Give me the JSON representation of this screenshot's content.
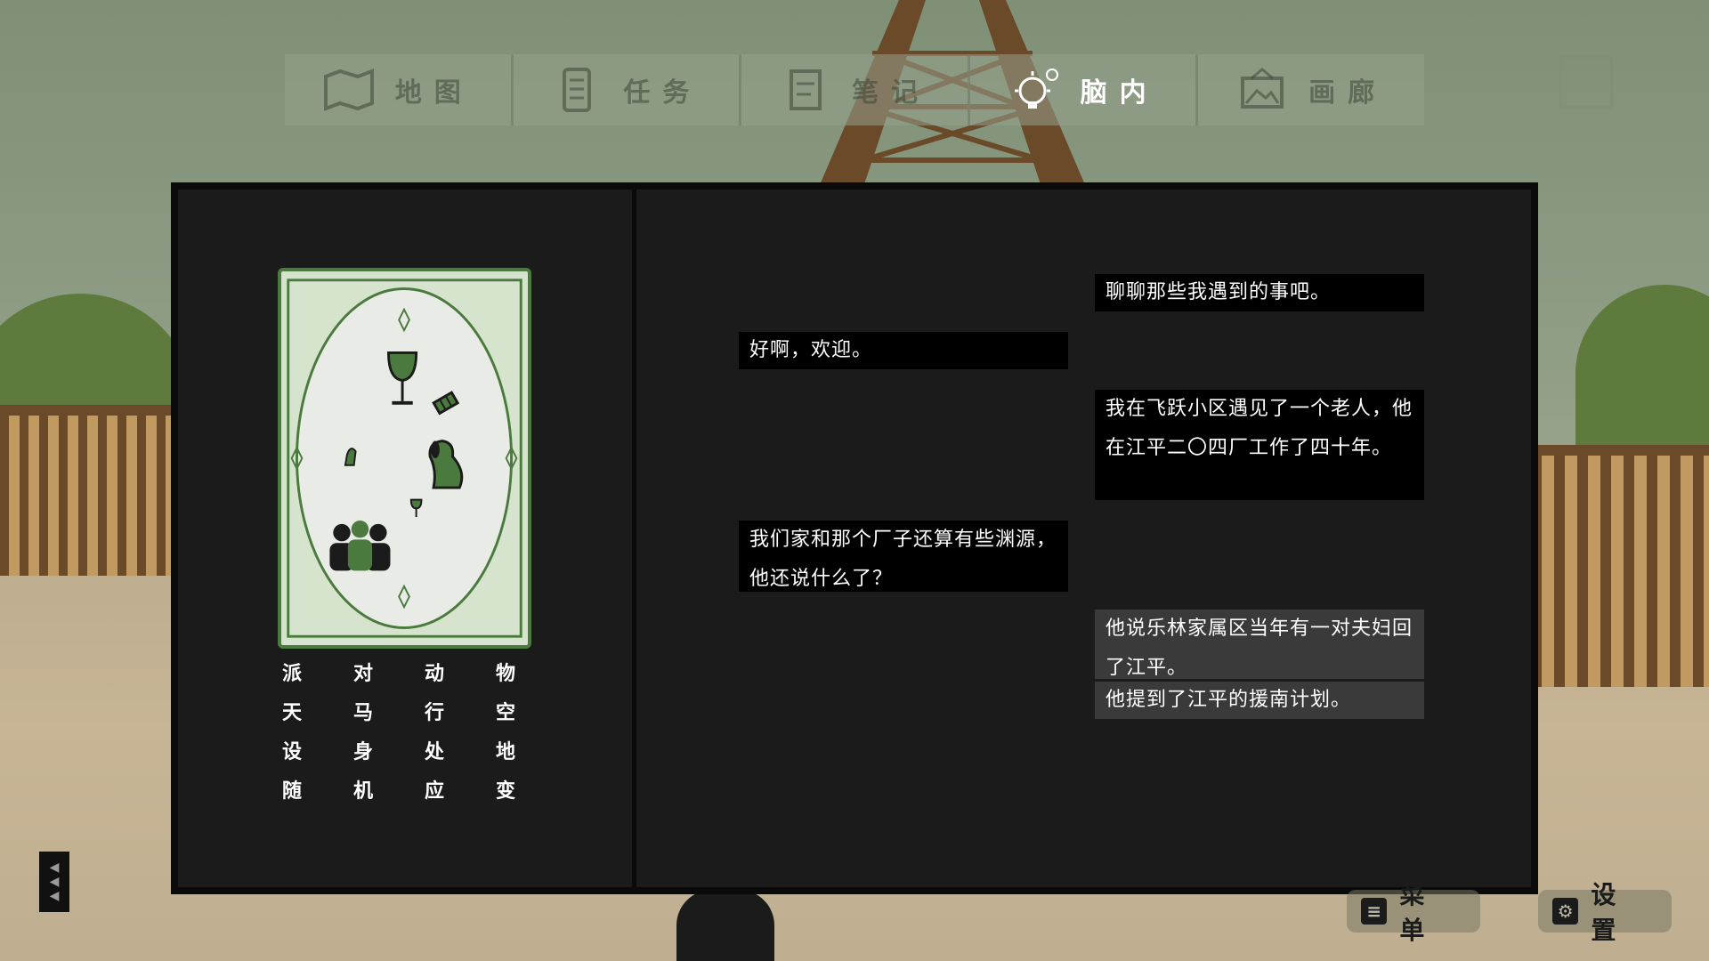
{
  "tabs": [
    {
      "label": "地图",
      "icon": "map-icon",
      "active": false
    },
    {
      "label": "任务",
      "icon": "task-list-icon",
      "active": false
    },
    {
      "label": "笔记",
      "icon": "notes-icon",
      "active": false
    },
    {
      "label": "脑内",
      "icon": "brain-idea-icon",
      "active": true
    },
    {
      "label": "画廊",
      "icon": "gallery-icon",
      "active": false
    }
  ],
  "card": {
    "icons": [
      "wine-glass-icon",
      "candy-icon",
      "dog-icon",
      "small-dog-icon",
      "small-wine-glass-icon",
      "people-group-icon"
    ]
  },
  "keywords": [
    "派",
    "对",
    "动",
    "物",
    "天",
    "马",
    "行",
    "空",
    "设",
    "身",
    "处",
    "地",
    "随",
    "机",
    "应",
    "变"
  ],
  "dialogue": [
    {
      "side": "right",
      "text": "聊聊那些我遇到的事吧。"
    },
    {
      "side": "left",
      "text": "好啊，欢迎。"
    },
    {
      "side": "right",
      "text": "我在飞跃小区遇见了一个老人，他在江平二〇四厂工作了四十年。"
    },
    {
      "side": "left",
      "text": "我们家和那个厂子还算有些渊源，他还说什么了？"
    }
  ],
  "choices": [
    "他说乐林家属区当年有一对夫妇回了江平。",
    "他提到了江平的援南计划。"
  ],
  "bottom": {
    "menu_label": "菜单",
    "settings_label": "设置"
  },
  "colors": {
    "panel_bg": "#1b1b1b",
    "bubble_bg": "#000000",
    "choice_bg": "#3a3a3a",
    "card_green": "#4b7a3e"
  }
}
